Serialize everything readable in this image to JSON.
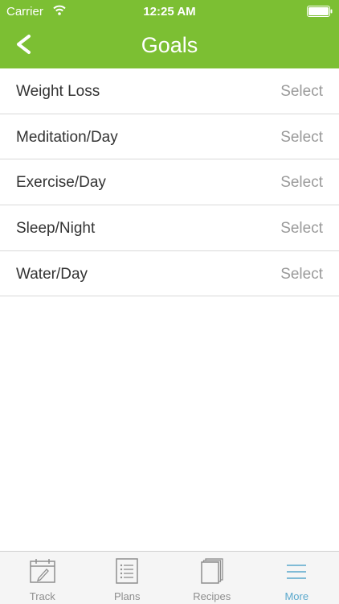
{
  "status_bar": {
    "carrier": "Carrier",
    "time": "12:25 AM"
  },
  "header": {
    "title": "Goals",
    "back_icon": "chevron-left-icon",
    "background": "#7cbf33"
  },
  "goals": [
    {
      "label": "Weight Loss",
      "value": "Select"
    },
    {
      "label": "Meditation/Day",
      "value": "Select"
    },
    {
      "label": "Exercise/Day",
      "value": "Select"
    },
    {
      "label": "Sleep/Night",
      "value": "Select"
    },
    {
      "label": "Water/Day",
      "value": "Select"
    }
  ],
  "tabs": [
    {
      "label": "Track",
      "icon": "calendar-pen-icon",
      "active": false
    },
    {
      "label": "Plans",
      "icon": "list-document-icon",
      "active": false
    },
    {
      "label": "Recipes",
      "icon": "stacked-pages-icon",
      "active": false
    },
    {
      "label": "More",
      "icon": "menu-lines-icon",
      "active": true
    }
  ],
  "colors": {
    "accent": "#7cbf33",
    "active_tab": "#5aa8cc",
    "inactive_tab": "#8e8e8e"
  }
}
